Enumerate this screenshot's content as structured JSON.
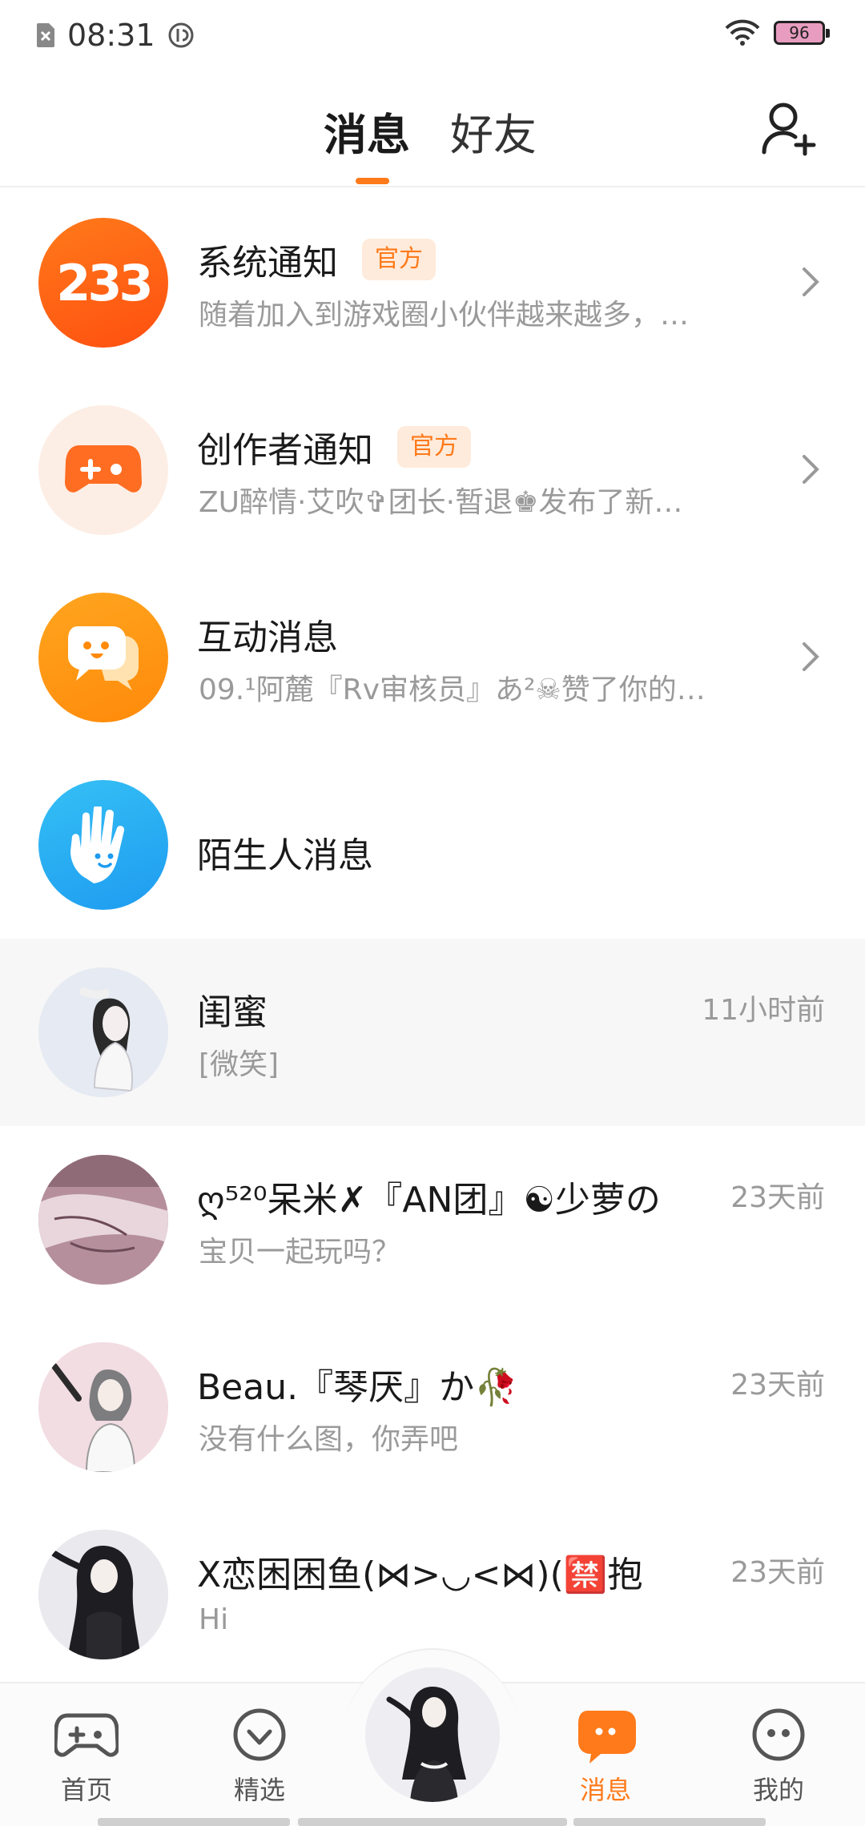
{
  "status_bar": {
    "time": "08:31",
    "battery": "96",
    "icons": [
      "sim-off-icon",
      "data-saver-icon",
      "wifi-icon",
      "battery-icon"
    ]
  },
  "header": {
    "tabs": [
      {
        "label": "消息",
        "active": true
      },
      {
        "label": "好友",
        "active": false
      }
    ],
    "add_friend_icon": "add-user-icon"
  },
  "system_rows": [
    {
      "title": "系统通知",
      "badge": "官方",
      "preview": "随着加入到游戏圈小伙伴越来越多，…",
      "avatar_text": "233"
    },
    {
      "title": "创作者通知",
      "badge": "官方",
      "preview": "ZU醉情·艾吹✞团长·暂退♚发布了新…",
      "avatar_icon": "gamepad-icon"
    },
    {
      "title": "互动消息",
      "preview": "09.¹阿麓『Rv审核员』あ²☠赞了你的…",
      "avatar_icon": "chat-smile-icon"
    },
    {
      "title": "陌生人消息",
      "avatar_icon": "waving-hand-icon"
    }
  ],
  "conversations": [
    {
      "name": "闺蜜",
      "preview": "[微笑]",
      "time": "11小时前",
      "highlighted": true
    },
    {
      "name": "ღ⁵²⁰呆米✗『AN团』☯少萝の",
      "preview": "宝贝一起玩吗？",
      "time": "23天前"
    },
    {
      "name": "Beau.『琴厌』か🥀",
      "preview": "没有什么图，你弄吧",
      "time": "23天前"
    },
    {
      "name": "X恋困困鱼(⋈>◡<⋈)(🈲抱",
      "preview": "Hi",
      "time": "23天前"
    }
  ],
  "bottom_nav": {
    "items": [
      {
        "label": "首页",
        "icon": "gamepad-icon",
        "active": false
      },
      {
        "label": "精选",
        "icon": "heart-badge-icon",
        "active": false
      },
      {
        "label": "消息",
        "icon": "message-bubble-icon",
        "active": true
      },
      {
        "label": "我的",
        "icon": "smiley-face-icon",
        "active": false
      }
    ]
  },
  "colors": {
    "accent": "#ff7a1a",
    "badge_bg": "#ffebdb",
    "muted_text": "#9a9a9a",
    "highlight_row": "#f7f7f7"
  }
}
